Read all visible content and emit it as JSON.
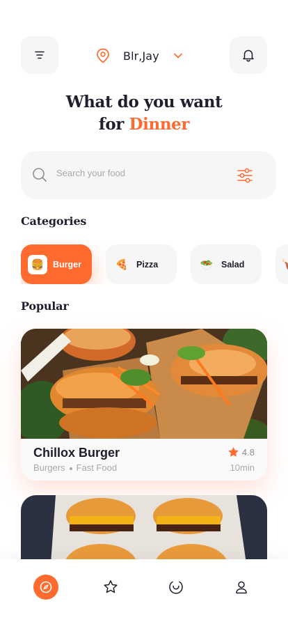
{
  "header": {
    "location": "Blr,Jay",
    "menu_icon": "filter-lines-icon",
    "location_icon": "map-pin-icon",
    "dropdown_icon": "chevron-down-icon",
    "notification_icon": "bell-icon"
  },
  "headline": {
    "line1": "What do you want",
    "line2_prefix": "for",
    "line2_accent": "Dinner"
  },
  "search": {
    "placeholder": "Search your food",
    "search_icon": "search-icon",
    "filter_icon": "sliders-icon"
  },
  "categories": {
    "title": "Categories",
    "items": [
      {
        "label": "Burger",
        "emoji": "🍔",
        "active": true
      },
      {
        "label": "Pizza",
        "emoji": "🍕",
        "active": false
      },
      {
        "label": "Salad",
        "emoji": "🥗",
        "active": false
      },
      {
        "label": "",
        "emoji": "🍗",
        "active": false
      }
    ]
  },
  "popular": {
    "title": "Popular",
    "items": [
      {
        "name": "Chillox Burger",
        "tag1": "Burgers",
        "tag2": "Fast Food",
        "rating": "4.8",
        "time": "10min"
      }
    ]
  },
  "nav": {
    "items": [
      "compass-icon",
      "star-icon",
      "orders-icon",
      "profile-icon"
    ],
    "active": "compass-icon"
  },
  "colors": {
    "accent": "#ff6a2f",
    "text": "#1d1d2c",
    "muted": "#a8a8ad",
    "surface": "#f6f6f6"
  }
}
